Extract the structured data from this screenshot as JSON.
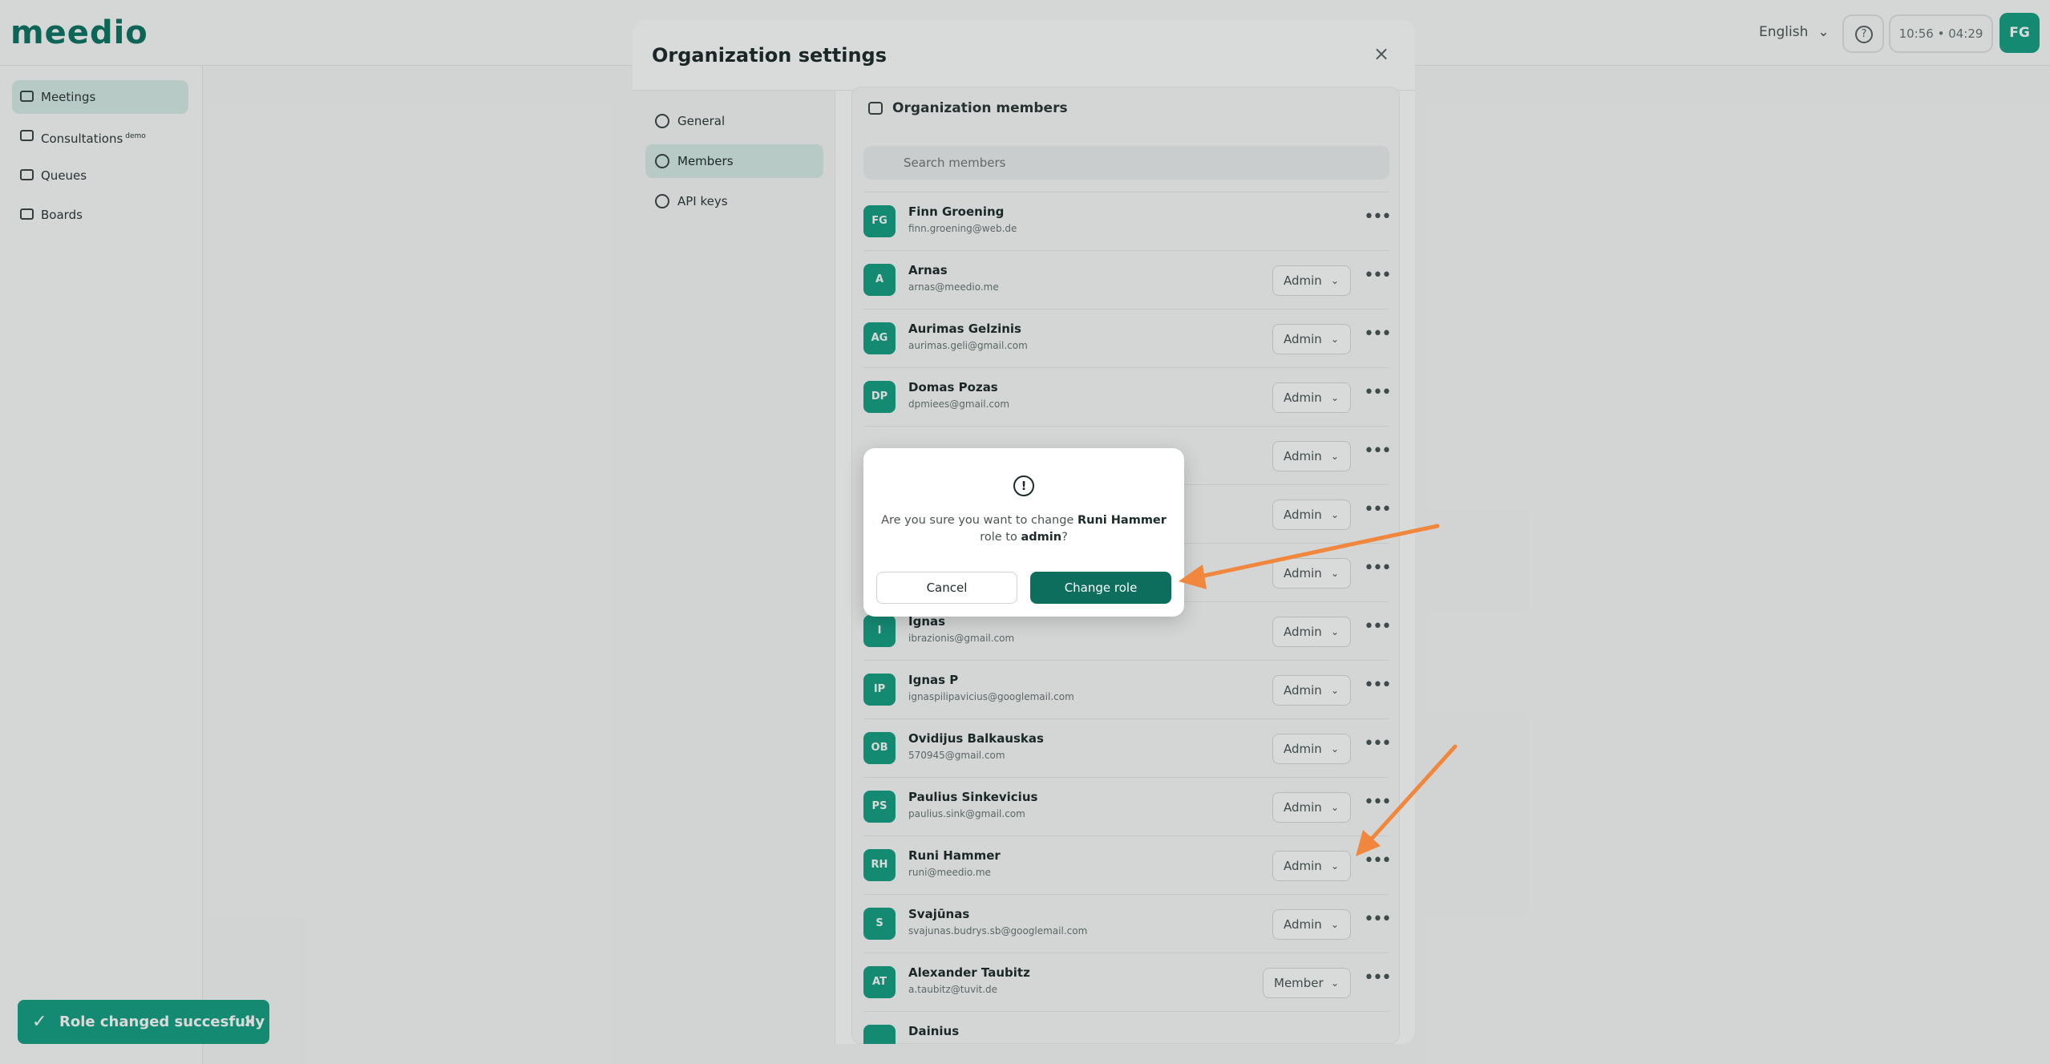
{
  "app": {
    "logo": "meedio",
    "language": "English",
    "time": "10:56 • 04:29",
    "user_initials": "FG"
  },
  "sidebar": {
    "items": [
      {
        "label": "Meetings",
        "badge": ""
      },
      {
        "label": "Consultations",
        "badge": "demo"
      },
      {
        "label": "Queues",
        "badge": ""
      },
      {
        "label": "Boards",
        "badge": ""
      }
    ]
  },
  "settings": {
    "title": "Organization settings",
    "close": "×",
    "menu": [
      {
        "label": "General"
      },
      {
        "label": "Members"
      },
      {
        "label": "API keys"
      }
    ]
  },
  "members_panel": {
    "title": "Organization members",
    "search_placeholder": "Search members",
    "members": [
      {
        "initials": "FG",
        "name": "Finn Groening",
        "email": "finn.groening@web.de",
        "role": ""
      },
      {
        "initials": "A",
        "name": "Arnas",
        "email": "arnas@meedio.me",
        "role": "Admin"
      },
      {
        "initials": "AG",
        "name": "Aurimas Gelzinis",
        "email": "aurimas.geli@gmail.com",
        "role": "Admin"
      },
      {
        "initials": "DP",
        "name": "Domas Pozas",
        "email": "dpmiees@gmail.com",
        "role": "Admin"
      },
      {
        "initials": "",
        "name": "",
        "email": "",
        "role": "Admin"
      },
      {
        "initials": "",
        "name": "",
        "email": "",
        "role": "Admin"
      },
      {
        "initials": "",
        "name": "",
        "email": "",
        "role": "Admin"
      },
      {
        "initials": "I",
        "name": "Ignas",
        "email": "ibrazionis@gmail.com",
        "role": "Admin"
      },
      {
        "initials": "IP",
        "name": "Ignas P",
        "email": "ignaspilipavicius@googlemail.com",
        "role": "Admin"
      },
      {
        "initials": "OB",
        "name": "Ovidijus Balkauskas",
        "email": "570945@gmail.com",
        "role": "Admin"
      },
      {
        "initials": "PS",
        "name": "Paulius Sinkevicius",
        "email": "paulius.sink@gmail.com",
        "role": "Admin"
      },
      {
        "initials": "RH",
        "name": "Runi Hammer",
        "email": "runi@meedio.me",
        "role": "Admin"
      },
      {
        "initials": "S",
        "name": "Svajūnas",
        "email": "svajunas.budrys.sb@googlemail.com",
        "role": "Admin"
      },
      {
        "initials": "AT",
        "name": "Alexander Taubitz",
        "email": "a.taubitz@tuvit.de",
        "role": "Member"
      },
      {
        "initials": "",
        "name": "Dainius",
        "email": "",
        "role": ""
      }
    ]
  },
  "confirm": {
    "prefix": "Are you sure you want to change",
    "name": "Runi Hammer",
    "middle": "role to",
    "role": "admin",
    "suffix": "?",
    "cancel_label": "Cancel",
    "confirm_label": "Change role"
  },
  "toast": {
    "message": "Role changed succesfully"
  },
  "colors": {
    "brand": "#0d7463",
    "avatar": "#16a085",
    "primary_button": "#0d6e5e",
    "annotation_arrow": "#f0873c"
  }
}
